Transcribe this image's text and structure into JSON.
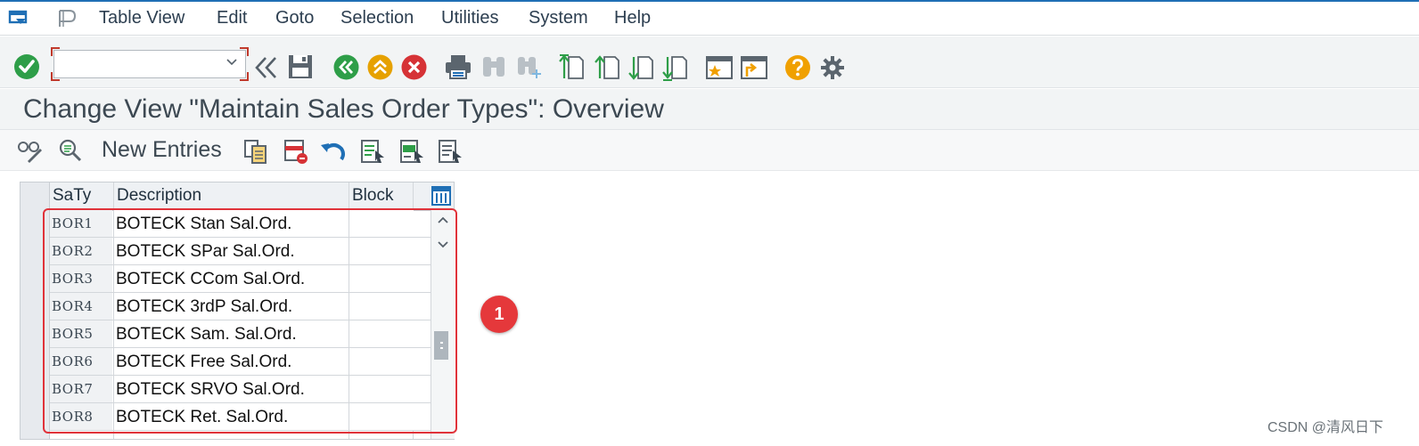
{
  "menu": {
    "items": [
      {
        "label": "Table View"
      },
      {
        "label": "Edit"
      },
      {
        "label": "Goto"
      },
      {
        "label": "Selection"
      },
      {
        "label": "Utilities"
      },
      {
        "label": "System"
      },
      {
        "label": "Help"
      }
    ]
  },
  "toolbar": {
    "command_field_value": "",
    "icons": [
      "enter-check-icon",
      "command-dropdown-icon",
      "collapse-toolbar-icon",
      "save-icon",
      "back-icon",
      "exit-icon",
      "cancel-icon",
      "print-icon",
      "find-icon",
      "find-next-icon",
      "first-page-icon",
      "previous-page-icon",
      "next-page-icon",
      "last-page-icon",
      "create-session-icon",
      "shortcut-icon",
      "help-icon",
      "settings-gear-icon"
    ]
  },
  "page": {
    "title": "Change View \"Maintain Sales Order Types\": Overview"
  },
  "app_toolbar": {
    "new_entries_label": "New Entries",
    "icons": [
      "display-change-icon",
      "details-icon",
      "copy-as-icon",
      "delete-icon",
      "undo-change-icon",
      "select-all-icon",
      "select-block-icon",
      "deselect-all-icon"
    ]
  },
  "table": {
    "columns": [
      {
        "label": "SaTy"
      },
      {
        "label": "Description"
      },
      {
        "label": "Block"
      }
    ],
    "rows": [
      {
        "key": "BOR1",
        "description": "BOTECK Stan Sal.Ord.",
        "block": ""
      },
      {
        "key": "BOR2",
        "description": "BOTECK SPar Sal.Ord.",
        "block": ""
      },
      {
        "key": "BOR3",
        "description": "BOTECK CCom Sal.Ord.",
        "block": ""
      },
      {
        "key": "BOR4",
        "description": "BOTECK 3rdP Sal.Ord.",
        "block": ""
      },
      {
        "key": "BOR5",
        "description": "BOTECK Sam. Sal.Ord.",
        "block": ""
      },
      {
        "key": "BOR6",
        "description": "BOTECK Free Sal.Ord.",
        "block": ""
      },
      {
        "key": "BOR7",
        "description": "BOTECK SRVO Sal.Ord.",
        "block": ""
      },
      {
        "key": "BOR8",
        "description": "BOTECK Ret. Sal.Ord.",
        "block": ""
      }
    ]
  },
  "annotation": {
    "badge_number": "1",
    "frame_color": "#e0323a"
  },
  "watermark": "CSDN @清风日下",
  "colors": {
    "accent_blue": "#1f6fb5",
    "enter_green": "#2e9e48",
    "exit_orange": "#e6a100",
    "cancel_red": "#d63236",
    "help_orange": "#f0a000"
  }
}
